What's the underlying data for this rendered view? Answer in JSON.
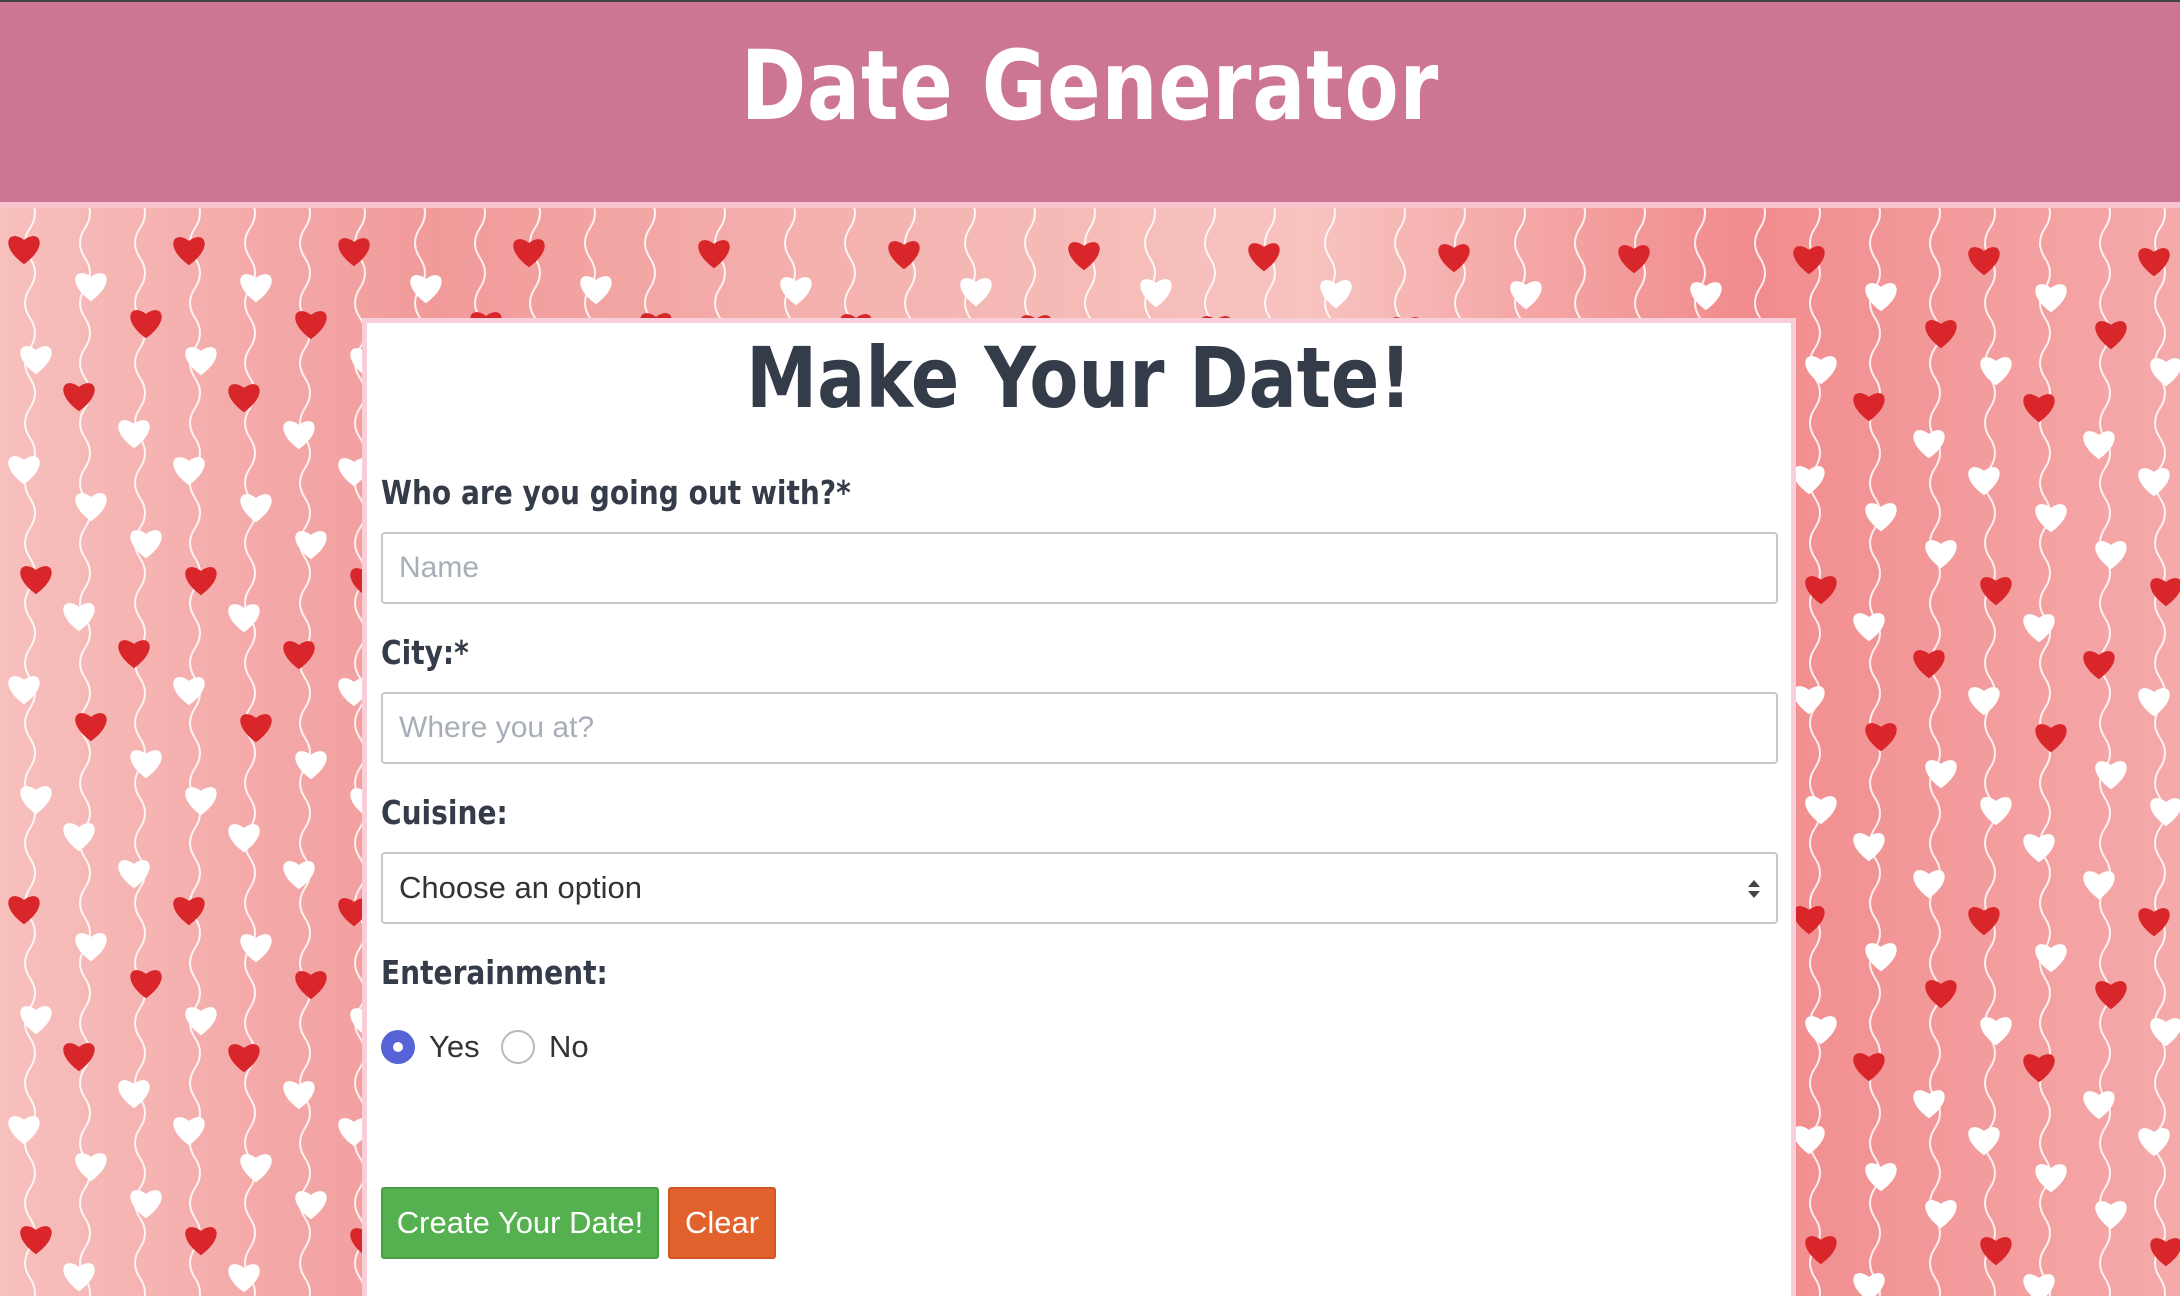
{
  "header": {
    "title": "Date Generator"
  },
  "form": {
    "title": "Make Your Date!",
    "name_label": "Who are you going out with?*",
    "name_placeholder": "Name",
    "city_label": "City:*",
    "city_placeholder": "Where you at?",
    "cuisine_label": "Cuisine:",
    "cuisine_selected": "Choose an option",
    "entertainment_label": "Enterainment:",
    "entertainment_options": [
      {
        "label": "Yes",
        "checked": true
      },
      {
        "label": "No",
        "checked": false
      }
    ],
    "create_button": "Create Your Date!",
    "clear_button": "Clear"
  },
  "colors": {
    "header_bg": "#cd7595",
    "radio_accent": "#5563d6",
    "create_button": "#55b04f",
    "clear_button": "#e2622d",
    "heart_red": "#d8262a",
    "heart_white": "#ffffff"
  },
  "icons": {
    "background_pattern": "heart-string-icon",
    "select_arrow": "sort-arrows-icon"
  }
}
